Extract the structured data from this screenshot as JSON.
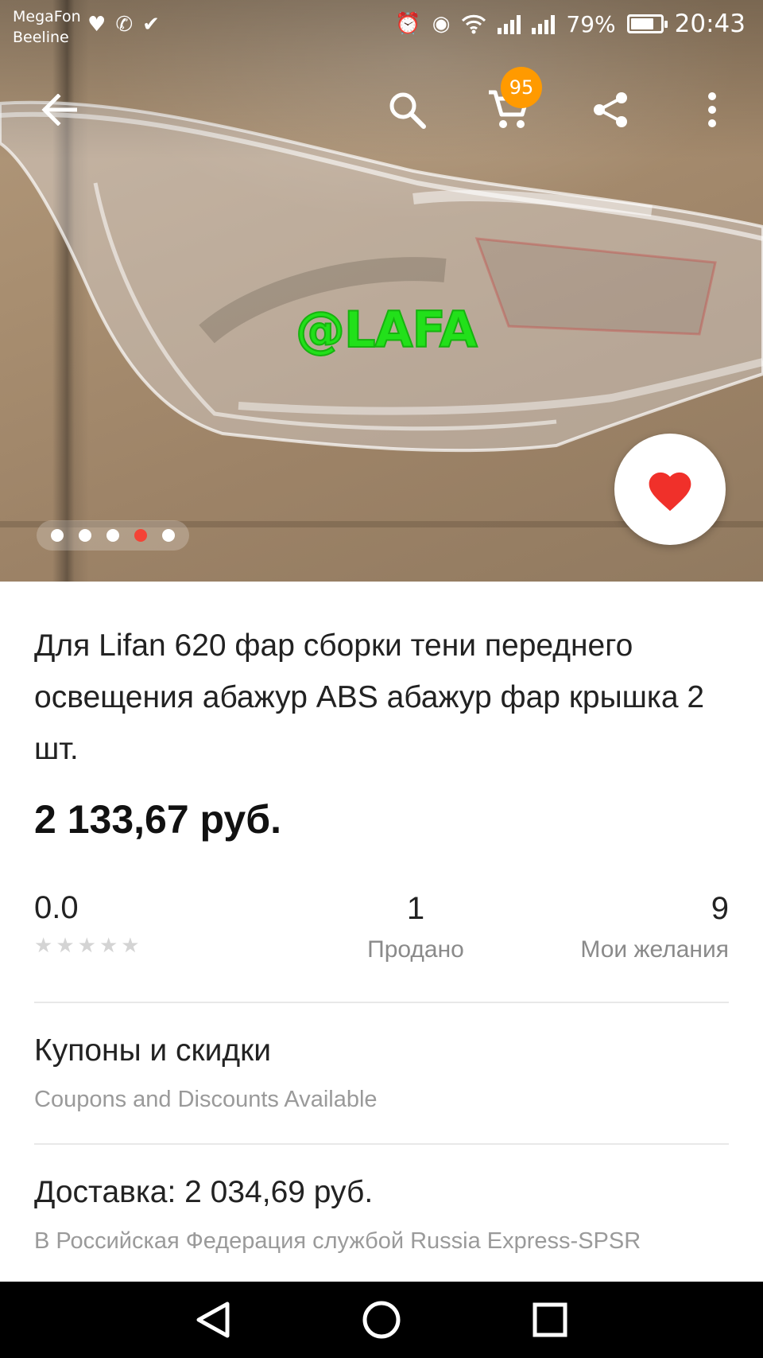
{
  "status_bar": {
    "carrier_1": "MegaFon",
    "carrier_2": "Beeline",
    "battery_percent": "79%",
    "battery_level": 0.79,
    "time": "20:43",
    "left_icons": [
      "heartbeat-icon",
      "whatsapp-icon",
      "play-icon"
    ],
    "right_icons": [
      "alarm-icon",
      "eye-icon",
      "wifi-icon",
      "signal-icon",
      "signal-icon",
      "battery-icon"
    ]
  },
  "toolbar": {
    "back_icon": "arrow-left-icon",
    "search_icon": "search-icon",
    "cart_icon": "cart-icon",
    "cart_count": "95",
    "share_icon": "share-icon",
    "more_icon": "more-vertical-icon"
  },
  "gallery": {
    "watermark": "@LAFA",
    "image_count": 5,
    "active_index": 3,
    "favorite_icon": "heart-icon"
  },
  "product": {
    "title": "Для Lifan 620 фар сборки тени переднего освещения абажур ABS абажур фар крышка 2 шт.",
    "price": "2 133,67 руб."
  },
  "stats": {
    "rating": "0.0",
    "stars_filled": 0,
    "stars_total": 5,
    "sold_count": "1",
    "sold_label": "Продано",
    "wishes_count": "9",
    "wishes_label": "Мои желания"
  },
  "coupons": {
    "title": "Купоны и скидки",
    "subtitle": "Coupons and Discounts Available"
  },
  "shipping": {
    "title": "Доставка: 2 034,69 руб.",
    "subtitle": "В Российская Федерация службой Russia Express-SPSR"
  },
  "nav": {
    "back_icon": "triangle-back-icon",
    "home_icon": "circle-home-icon",
    "recent_icon": "square-recents-icon"
  },
  "colors": {
    "accent_red": "#f44336",
    "badge_orange": "#ff9a00",
    "watermark_green": "#22e01a",
    "muted_text": "#9a9a9a"
  }
}
